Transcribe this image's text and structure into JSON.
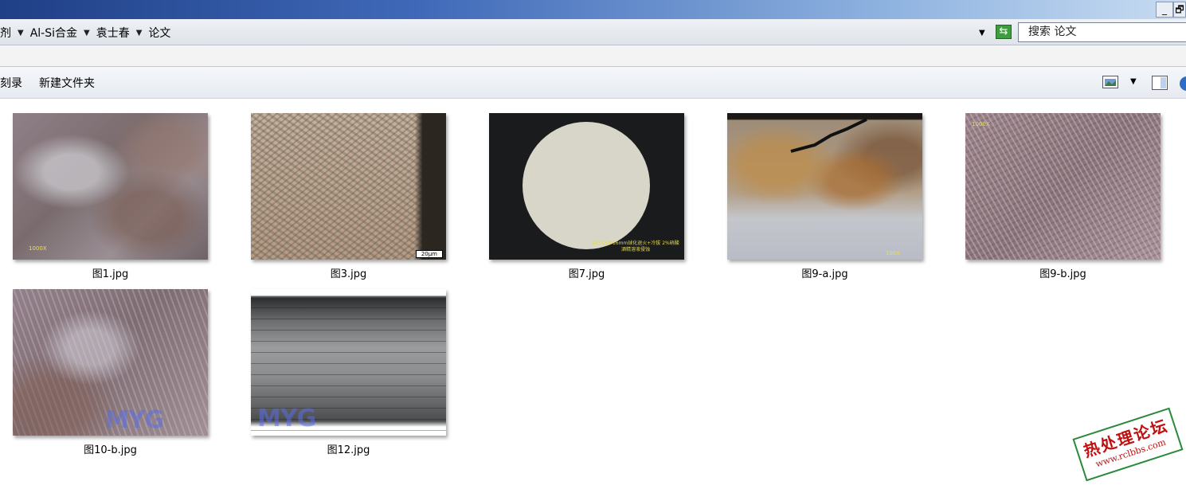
{
  "window": {
    "minimize": "_",
    "restore": "🗗"
  },
  "address": {
    "crumbs": [
      "剂",
      "Al-Si合金",
      "袁士春",
      "论文"
    ],
    "search_placeholder": "搜索 论文"
  },
  "toolbar": {
    "burn_label": "刻录",
    "new_folder_label": "新建文件夹"
  },
  "files": [
    {
      "name": "图1.jpg",
      "overlay": "1000X"
    },
    {
      "name": "图3.jpg",
      "overlay": "20μm"
    },
    {
      "name": "图7.jpg",
      "overlay": "GCr15/Φ16mm球化退火+冷拔 2%硝酸酒精溶液侵蚀"
    },
    {
      "name": "图9-a.jpg",
      "overlay": "100X"
    },
    {
      "name": "图9-b.jpg",
      "overlay": "1000X"
    },
    {
      "name": "图10-b.jpg",
      "overlay": "MYG"
    },
    {
      "name": "图12.jpg",
      "overlay": "MYG"
    }
  ],
  "watermark": {
    "title": "热处理论坛",
    "url": "www.rclbbs.com"
  },
  "colors": {
    "titlebar": "#1f3f86",
    "accent": "#3d9e3d",
    "watermark_red": "#c01010"
  }
}
